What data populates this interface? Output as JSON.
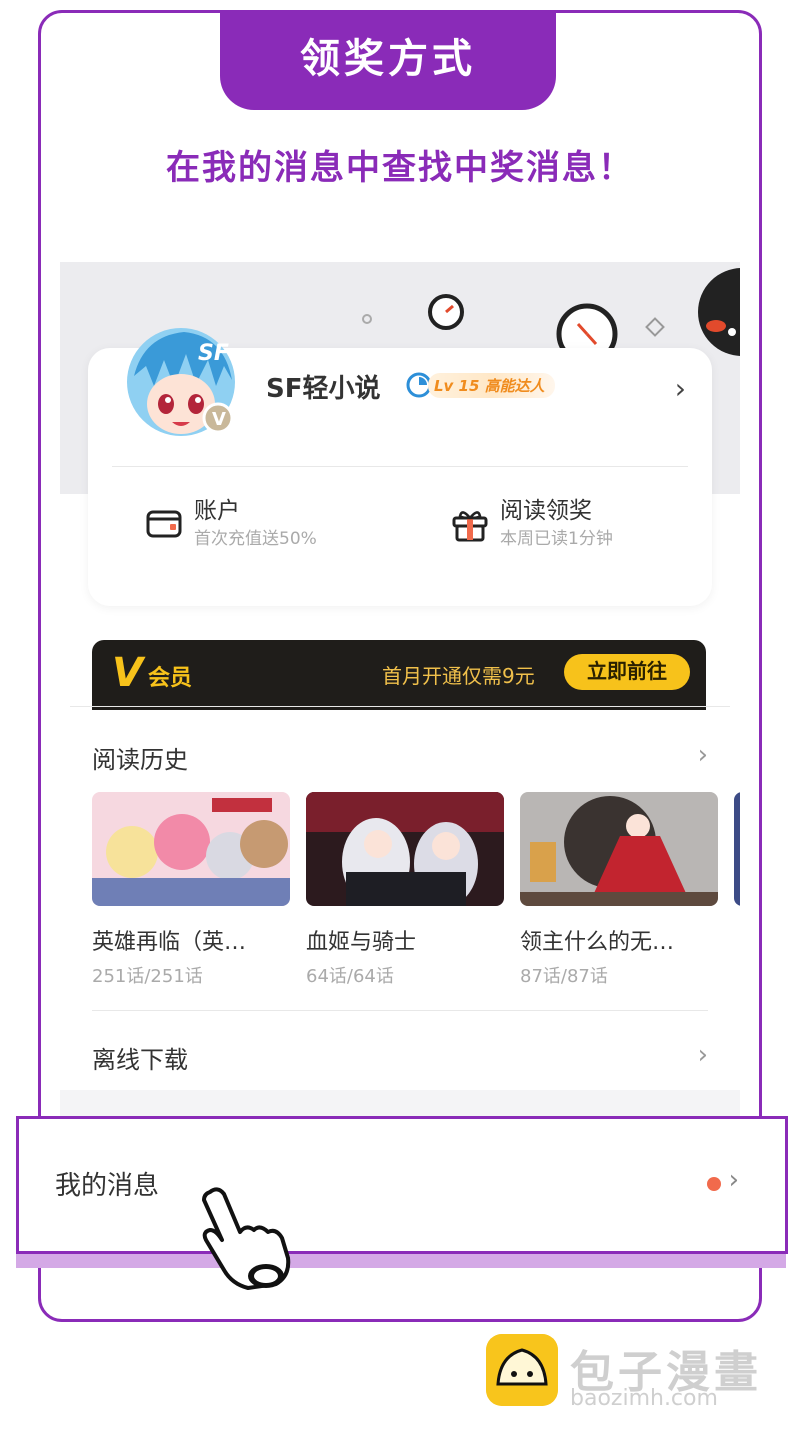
{
  "header": {
    "title": "领奖方式",
    "subtitle": "在我的消息中查找中奖消息！"
  },
  "profile": {
    "username": "SF轻小说",
    "level": "Lv 15 高能达人",
    "avatar_badge": "V"
  },
  "stats": [
    {
      "title": "账户",
      "sub": "首次充值送50%"
    },
    {
      "title": "阅读领奖",
      "sub": "本周已读1分钟"
    }
  ],
  "vip": {
    "logo": "V",
    "label": "会员",
    "promo": "首月开通仅需9元",
    "button": "立即前往"
  },
  "history": {
    "title": "阅读历史",
    "books": [
      {
        "title": "英雄再临（英…",
        "count": "251话/251话"
      },
      {
        "title": "血姬与骑士",
        "count": "64话/64话"
      },
      {
        "title": "领主什么的无…",
        "count": "87话/87话"
      }
    ]
  },
  "offline": {
    "title": "离线下载"
  },
  "messages": {
    "title": "我的消息"
  },
  "watermark": {
    "name": "包子漫畫",
    "domain": "baozimh.com"
  },
  "colors": {
    "accent": "#8a2bb8",
    "vip_gold": "#f7c21b",
    "dot": "#f16a4c"
  }
}
